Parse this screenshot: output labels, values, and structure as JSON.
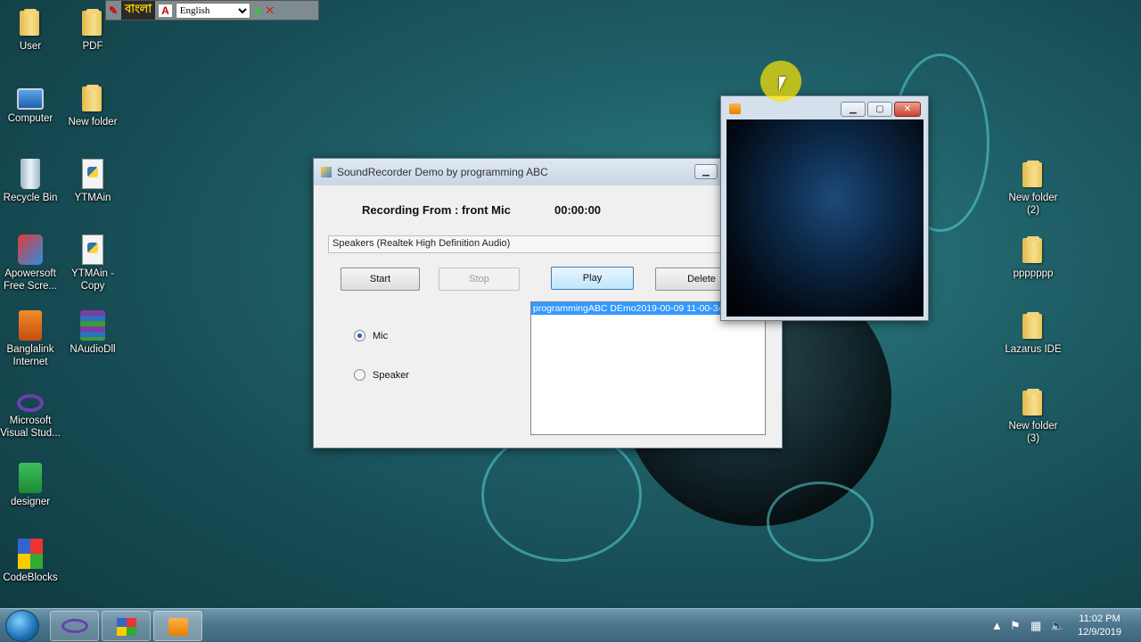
{
  "language_bar": {
    "bangla_label": "বাংলা",
    "language": "English",
    "options": [
      "English"
    ]
  },
  "desktop": {
    "left_icons": [
      {
        "label": "User",
        "icon": "user-folder-icon"
      },
      {
        "label": "PDF",
        "icon": "folder-icon"
      },
      {
        "label": "Computer",
        "icon": "computer-icon"
      },
      {
        "label": "New folder",
        "icon": "folder-icon"
      },
      {
        "label": "Recycle Bin",
        "icon": "recycle-bin-icon"
      },
      {
        "label": "YTMAin",
        "icon": "python-file-icon"
      },
      {
        "label": "Apowersoft Free Scre...",
        "icon": "apowersoft-icon"
      },
      {
        "label": "YTMAin - Copy",
        "icon": "python-file-icon"
      },
      {
        "label": "Banglalink Internet",
        "icon": "banglalink-icon"
      },
      {
        "label": "NAudioDll",
        "icon": "archive-icon"
      },
      {
        "label": "Microsoft Visual Stud...",
        "icon": "visual-studio-icon"
      },
      {
        "label": "designer",
        "icon": "designer-icon"
      },
      {
        "label": "CodeBlocks",
        "icon": "codeblocks-icon"
      }
    ],
    "right_icons": [
      {
        "label": "New folder (2)",
        "icon": "folder-icon"
      },
      {
        "label": "ppppppp",
        "icon": "folder-icon"
      },
      {
        "label": "Lazarus IDE",
        "icon": "folder-icon"
      },
      {
        "label": "New folder (3)",
        "icon": "folder-icon"
      }
    ]
  },
  "recorder": {
    "title": "SoundRecorder Demo by programming ABC",
    "recording_label": "Recording From : front Mic",
    "timer": "00:00:00",
    "device": "Speakers (Realtek High Definition Audio)",
    "buttons": {
      "start": "Start",
      "stop": "Stop",
      "play": "Play",
      "delete": "Delete"
    },
    "radio_mic": "Mic",
    "radio_speaker": "Speaker",
    "selected_source": "Mic",
    "files": [
      "programmingABC DEmo2019-00-09 11-00-34.w"
    ]
  },
  "player": {
    "icon": "media-player-icon"
  },
  "taskbar": {
    "time": "11:02 PM",
    "date": "12/9/2019"
  }
}
